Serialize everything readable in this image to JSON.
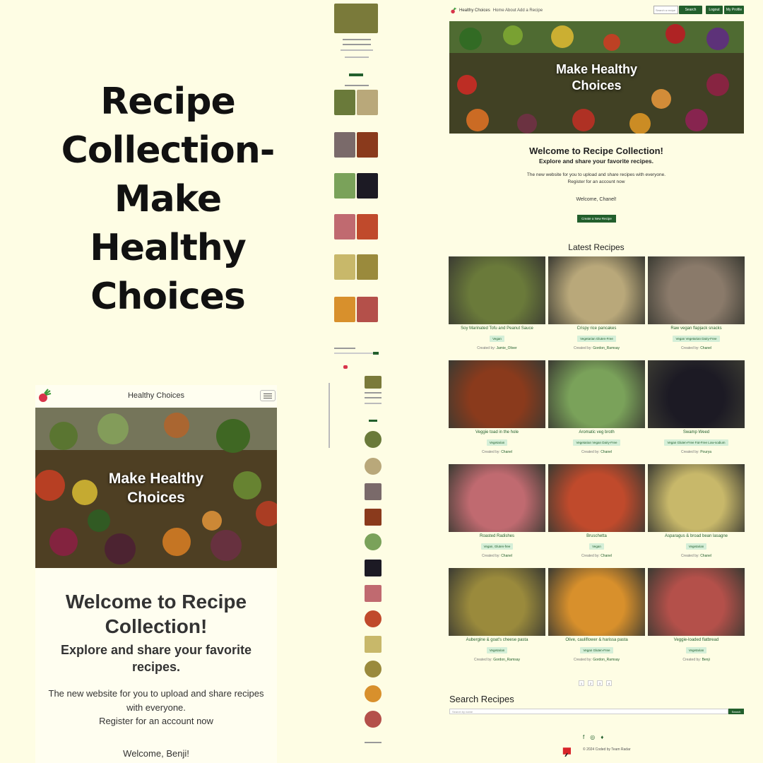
{
  "hero_title": "Recipe Collection- Make Healthy Choices",
  "mobile": {
    "brand": "Healthy Choices",
    "hero_text": "Make Healthy Choices",
    "welcome": "Welcome to Recipe Collection!",
    "explore": "Explore and share your favorite recipes.",
    "desc_line1": "The new website for you to upload and share recipes with everyone.",
    "desc_line2": "Register for an account now",
    "welcome_user": "Welcome, Benji!"
  },
  "desktop": {
    "nav": {
      "brand": "Healthy Choices",
      "links": "Home   About   Add a Recipe",
      "search_placeholder": "Search a recipe",
      "search_button": "Search",
      "logout": "Logout",
      "profile": "My Profile"
    },
    "hero_text": "Make Healthy Choices",
    "welcome": "Welcome to Recipe Collection!",
    "explore": "Explore and share your favorite recipes.",
    "desc_line1": "The new website for you to upload and share recipes with everyone.",
    "desc_line2": "Register for an account now",
    "welcome_user": "Welcome, Chanel!",
    "create_button": "Create a New Recipe",
    "latest_heading": "Latest Recipes",
    "recipes": [
      {
        "title": "Soy Marinated Tofu and Peanut Sauce",
        "tags": "Vegan",
        "by": "Created by: ",
        "author": "Jamie_Oliver",
        "color": "#6a7a3a"
      },
      {
        "title": "Crispy rice pancakes",
        "tags": "Vegetarian Gluten-Free",
        "by": "Created by: ",
        "author": "Gordon_Ramsay",
        "color": "#b9a87a"
      },
      {
        "title": "Raw vegan flapjack snacks",
        "tags": "Vegan Vegetarian Dairy-Free",
        "by": "Created by: ",
        "author": "Chanel",
        "color": "#8a7a6a"
      },
      {
        "title": "Veggie toad in the hole",
        "tags": "Vegetarian",
        "by": "Created by: ",
        "author": "Chanel",
        "color": "#8a3a1c"
      },
      {
        "title": "Aromatic veg broth",
        "tags": "Vegetarian Vegan Dairy-Free",
        "by": "Created by: ",
        "author": "Chanel",
        "color": "#7aa25a"
      },
      {
        "title": "Swamp Weed",
        "tags": "Vegan Gluten-Free Fat-Free Low-sodium",
        "by": "Created by: ",
        "author": "Pourya",
        "color": "#1c1a24"
      },
      {
        "title": "Roasted Radishes",
        "tags": "Vegan, Gluten-free",
        "by": "Created by: ",
        "author": "Chanel",
        "color": "#c06a70"
      },
      {
        "title": "Bruschetta",
        "tags": "Vegan",
        "by": "Created by: ",
        "author": "Chanel",
        "color": "#c04a2c"
      },
      {
        "title": "Asparagus & broad bean lasagne",
        "tags": "Vegetarian",
        "by": "Created by: ",
        "author": "Chanel",
        "color": "#c8b86a"
      },
      {
        "title": "Aubergine & goat's cheese pasta",
        "tags": "Vegetarian",
        "by": "Created by: ",
        "author": "Gordon_Ramsay",
        "color": "#9a8a3c"
      },
      {
        "title": "Olive, cauliflower & harissa pasta",
        "tags": "Vegan Gluten-Free",
        "by": "Created by: ",
        "author": "Gordon_Ramsay",
        "color": "#d8902c"
      },
      {
        "title": "Veggie-loaded flatbread",
        "tags": "Vegetarian",
        "by": "Created by: ",
        "author": "Benji",
        "color": "#b4504a"
      }
    ],
    "pages": [
      "1",
      "2",
      "3",
      "4"
    ],
    "search_heading": "Search Recipes",
    "search_placeholder": "Search by name",
    "search_button": "Search",
    "footer": "© 2024 Coded by Team Radar"
  },
  "colors": {
    "accent": "#225f2c",
    "background": "#fefde4",
    "tag_bg": "#d5efd8"
  }
}
